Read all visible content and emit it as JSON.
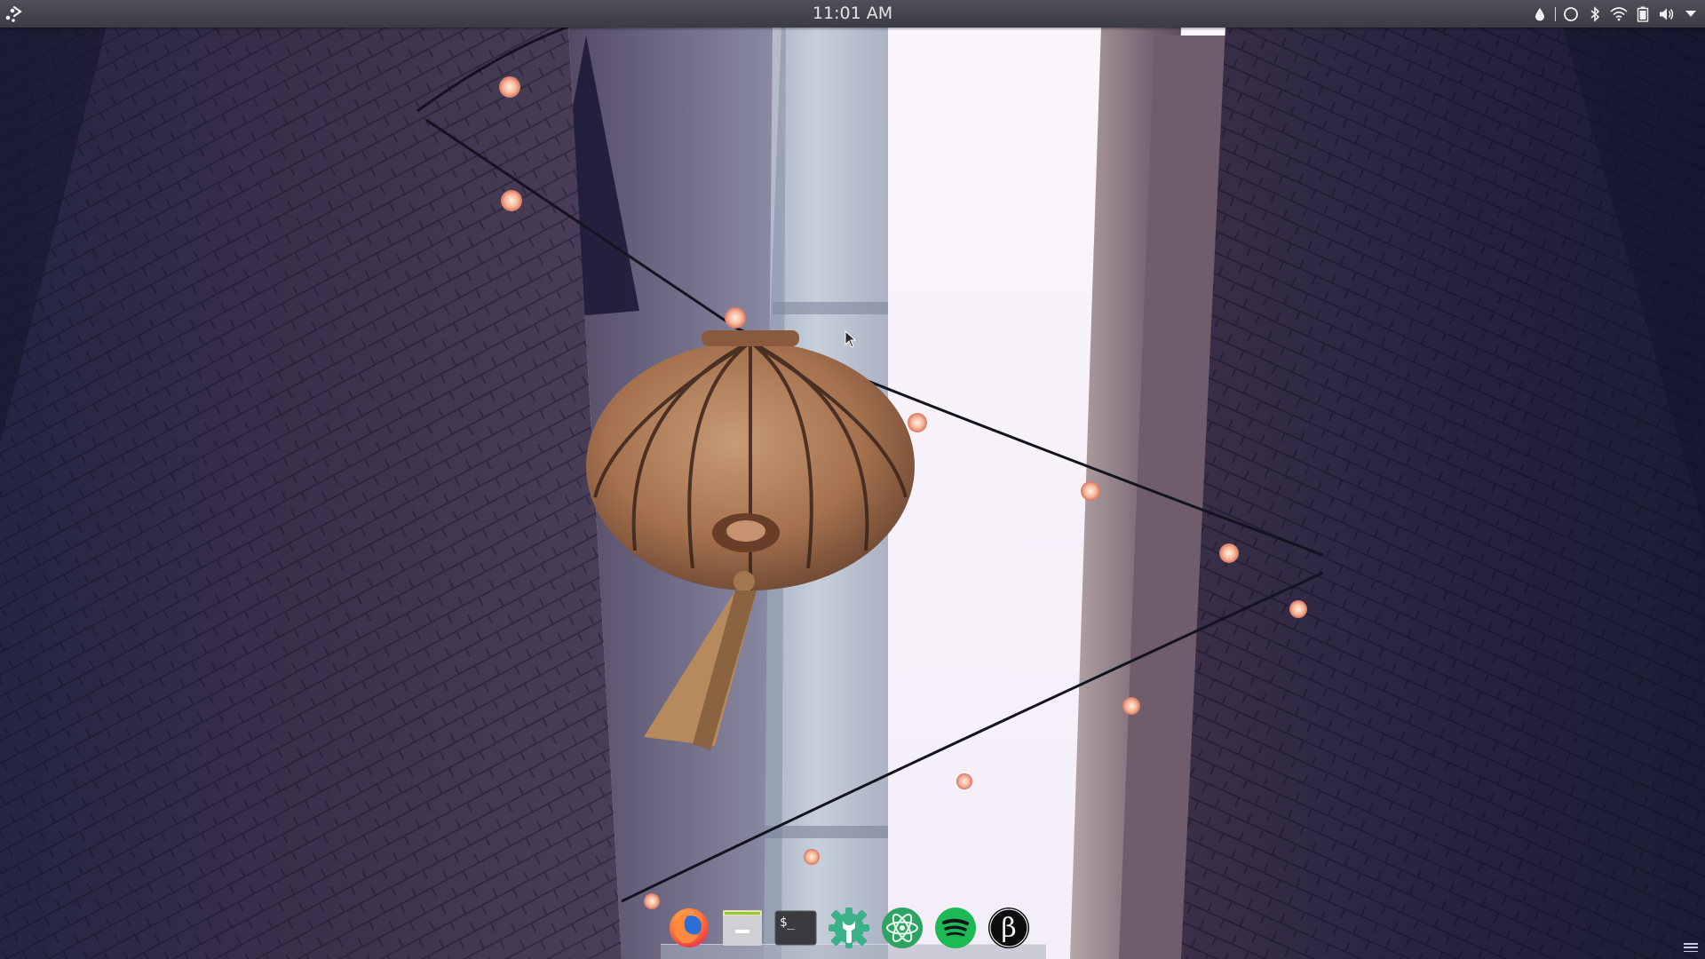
{
  "top_panel": {
    "clock": "11:01 AM",
    "tray_icons": [
      "droplet-icon",
      "circle-icon",
      "bluetooth-icon",
      "wifi-icon",
      "battery-icon",
      "volume-icon",
      "caret-down-icon"
    ]
  },
  "dock": {
    "items": [
      {
        "name": "firefox",
        "icon": "firefox-icon"
      },
      {
        "name": "files",
        "icon": "file-manager-icon"
      },
      {
        "name": "terminal",
        "icon": "terminal-icon",
        "glyph": "$_"
      },
      {
        "name": "settings",
        "icon": "system-settings-icon"
      },
      {
        "name": "atom",
        "icon": "atom-icon"
      },
      {
        "name": "spotify",
        "icon": "spotify-icon"
      },
      {
        "name": "beta-app",
        "icon": "beta-icon",
        "glyph": "β"
      }
    ]
  },
  "wallpaper": {
    "subject": "lantern-alley-icon"
  },
  "colors": {
    "panel": "#44454c",
    "panel_text": "#e4e4e8",
    "firefox": "#e66a2c",
    "spotify": "#1db954",
    "atom_bg": "#2fa363",
    "terminal_bg": "#3a3b3f"
  }
}
